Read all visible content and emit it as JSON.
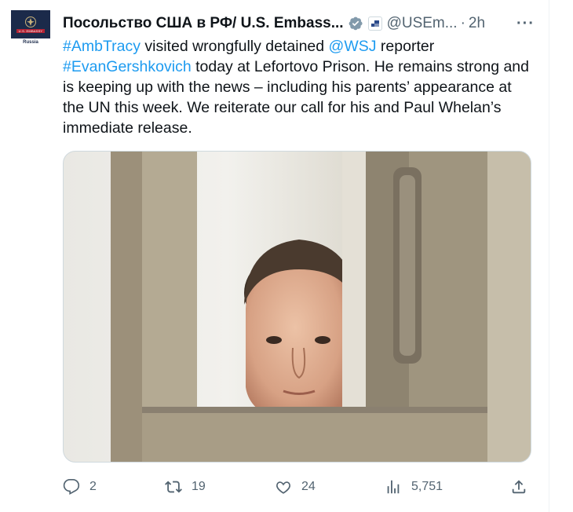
{
  "author": {
    "display_name": "Посольство США в РФ/ U.S. Embass...",
    "handle": "@USEm...",
    "separator": "·",
    "time": "2h",
    "more": "···",
    "avatar": {
      "banner_text": "U.S. EMBASSY",
      "country_text": "Russia"
    }
  },
  "tweet": {
    "segments": [
      {
        "type": "hashtag",
        "text": "#AmbTracy"
      },
      {
        "type": "text",
        "text": " visited wrongfully detained "
      },
      {
        "type": "mention",
        "text": "@WSJ"
      },
      {
        "type": "text",
        "text": " reporter "
      },
      {
        "type": "hashtag",
        "text": "#EvanGershkovich"
      },
      {
        "type": "text",
        "text": " today at Lefortovo Prison. He remains strong and is keeping up with the news – including his parents’ appearance at the UN this week. We reiterate our call for his and Paul Whelan’s immediate release."
      }
    ]
  },
  "media": {
    "description": "photo of a man looking through the bars of a cage"
  },
  "actions": {
    "reply_count": "2",
    "retweet_count": "19",
    "like_count": "24",
    "view_count": "5,751"
  },
  "colors": {
    "link": "#1d9bf0",
    "verified": "#829aab",
    "secondary_text": "#536471"
  },
  "icons": [
    "verified-badge-icon",
    "affiliate-icon",
    "more-icon",
    "reply-icon",
    "retweet-icon",
    "like-icon",
    "views-icon",
    "share-icon"
  ]
}
